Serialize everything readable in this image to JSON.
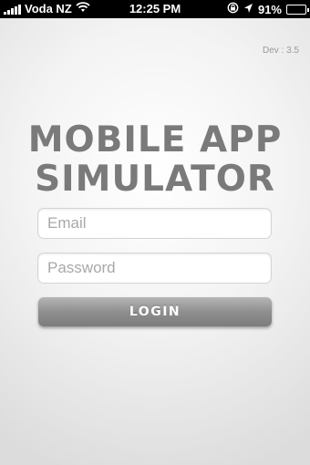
{
  "status_bar": {
    "carrier": "Voda NZ",
    "time": "12:25 PM",
    "battery_percent": "91%",
    "battery_level": 0.91,
    "icons": [
      "signal-bars-icon",
      "wifi-icon",
      "rotation-lock-icon",
      "location-arrow-icon",
      "battery-icon"
    ]
  },
  "app": {
    "version_label": "Dev : 3.5",
    "title_line1": "MOBILE APP",
    "title_line2": "SIMULATOR"
  },
  "login_form": {
    "email_placeholder": "Email",
    "email_value": "",
    "password_placeholder": "Password",
    "password_value": "",
    "login_label": "LOGIN"
  },
  "colors": {
    "title": "#7a7a7a",
    "button": "#8f8f8f",
    "status_bar": "#000000"
  }
}
